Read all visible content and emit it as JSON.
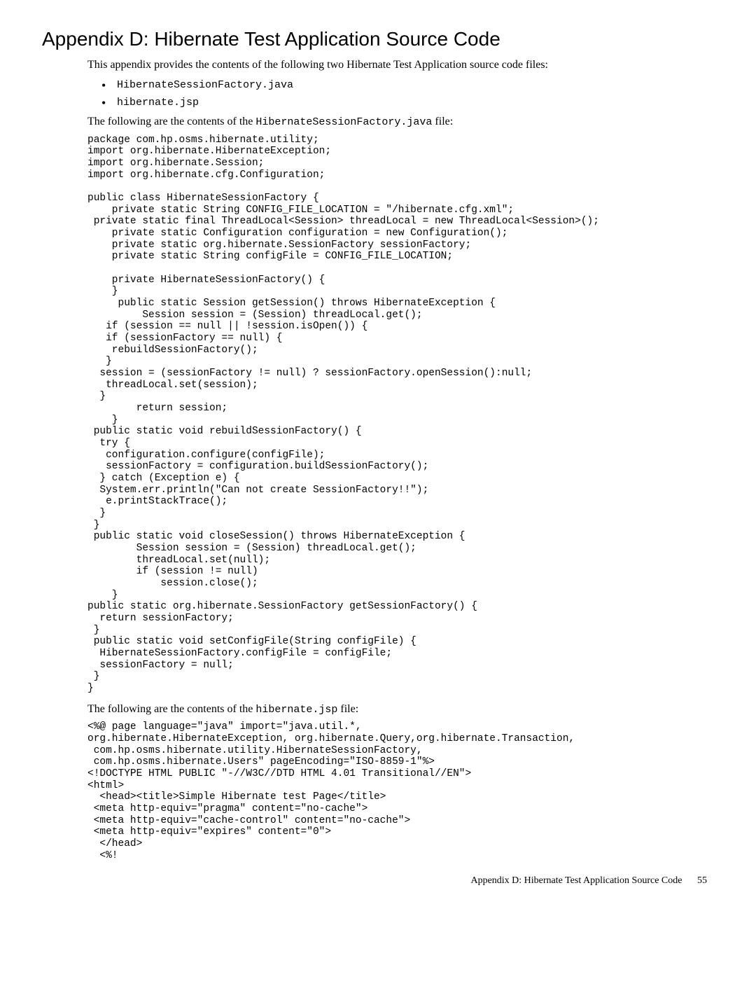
{
  "title": "Appendix D: Hibernate Test Application Source Code",
  "intro": "This appendix provides the contents of the following two Hibernate Test Application source code files:",
  "files": [
    "HibernateSessionFactory.java",
    "hibernate.jsp"
  ],
  "lead1_a": "The following are the contents of the ",
  "lead1_b": "HibernateSessionFactory.java",
  "lead1_c": " file:",
  "code1": "package com.hp.osms.hibernate.utility;\nimport org.hibernate.HibernateException;\nimport org.hibernate.Session;\nimport org.hibernate.cfg.Configuration;\n\npublic class HibernateSessionFactory {\n    private static String CONFIG_FILE_LOCATION = \"/hibernate.cfg.xml\";\n private static final ThreadLocal<Session> threadLocal = new ThreadLocal<Session>();\n    private static Configuration configuration = new Configuration();\n    private static org.hibernate.SessionFactory sessionFactory;\n    private static String configFile = CONFIG_FILE_LOCATION;\n\n    private HibernateSessionFactory() {\n    }\n     public static Session getSession() throws HibernateException {\n         Session session = (Session) threadLocal.get();\n   if (session == null || !session.isOpen()) {\n   if (sessionFactory == null) {\n    rebuildSessionFactory();\n   }\n  session = (sessionFactory != null) ? sessionFactory.openSession():null;\n   threadLocal.set(session);\n  }\n        return session;\n    }\n public static void rebuildSessionFactory() {\n  try {\n   configuration.configure(configFile);\n   sessionFactory = configuration.buildSessionFactory();\n  } catch (Exception e) {\n  System.err.println(\"Can not create SessionFactory!!\");\n   e.printStackTrace();\n  }\n }\n public static void closeSession() throws HibernateException {\n        Session session = (Session) threadLocal.get();\n        threadLocal.set(null);\n        if (session != null)\n            session.close();\n    }\npublic static org.hibernate.SessionFactory getSessionFactory() {\n  return sessionFactory;\n }\n public static void setConfigFile(String configFile) {\n  HibernateSessionFactory.configFile = configFile;\n  sessionFactory = null;\n }\n}",
  "lead2_a": "The following are the contents of the ",
  "lead2_b": "hibernate.jsp",
  "lead2_c": " file:",
  "code2": "<%@ page language=\"java\" import=\"java.util.*,\norg.hibernate.HibernateException, org.hibernate.Query,org.hibernate.Transaction,\n com.hp.osms.hibernate.utility.HibernateSessionFactory,\n com.hp.osms.hibernate.Users\" pageEncoding=\"ISO-8859-1\"%>\n<!DOCTYPE HTML PUBLIC \"-//W3C//DTD HTML 4.01 Transitional//EN\">\n<html>\n  <head><title>Simple Hibernate test Page</title>\n <meta http-equiv=\"pragma\" content=\"no-cache\">\n <meta http-equiv=\"cache-control\" content=\"no-cache\">\n <meta http-equiv=\"expires\" content=\"0\">\n  </head>\n  <%!",
  "footer_label": "Appendix D: Hibernate Test Application Source Code",
  "footer_page": "55"
}
